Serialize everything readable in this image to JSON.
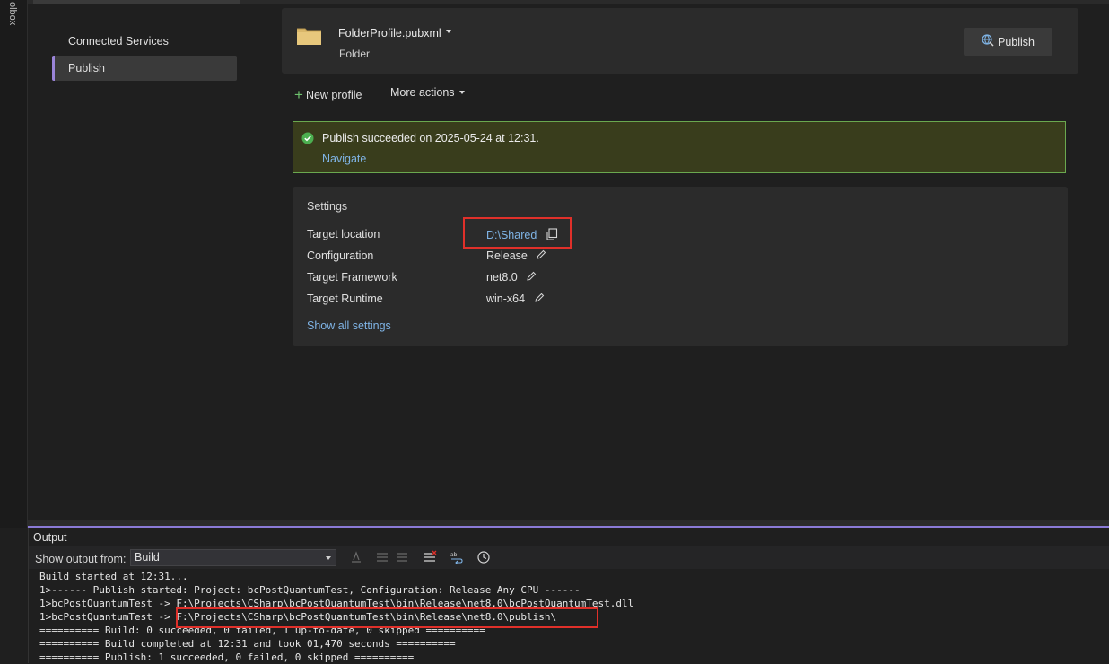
{
  "toolbox": {
    "label": "olbox"
  },
  "nav": {
    "items": [
      {
        "label": "Connected Services",
        "active": false
      },
      {
        "label": "Publish",
        "active": true
      }
    ]
  },
  "profile": {
    "name": "FolderProfile.pubxml",
    "type": "Folder",
    "publish_label": "Publish",
    "folder_icon": "folder-icon",
    "publish_icon": "globe-publish-icon"
  },
  "actions": {
    "new_profile": "New profile",
    "more_actions": "More actions"
  },
  "banner": {
    "message": "Publish succeeded on 2025-05-24 at 12:31.",
    "link": "Navigate",
    "status_color": "#6aa84f"
  },
  "settings": {
    "title": "Settings",
    "rows": [
      {
        "label": "Target location",
        "value": "D:\\Shared",
        "icon": "copy-icon"
      },
      {
        "label": "Configuration",
        "value": "Release",
        "icon": "pencil-icon"
      },
      {
        "label": "Target Framework",
        "value": "net8.0",
        "icon": "pencil-icon"
      },
      {
        "label": "Target Runtime",
        "value": "win-x64",
        "icon": "pencil-icon"
      }
    ],
    "show_all": "Show all settings"
  },
  "output": {
    "title": "Output",
    "show_from_label": "Show output from:",
    "source": "Build",
    "lines": [
      "Build started at 12:31...",
      "1>------ Publish started: Project: bcPostQuantumTest, Configuration: Release Any CPU ------",
      "1>bcPostQuantumTest -> F:\\Projects\\CSharp\\bcPostQuantumTest\\bin\\Release\\net8.0\\bcPostQuantumTest.dll",
      "1>bcPostQuantumTest -> F:\\Projects\\CSharp\\bcPostQuantumTest\\bin\\Release\\net8.0\\publish\\",
      "========== Build: 0 succeeded, 0 failed, 1 up-to-date, 0 skipped ==========",
      "========== Build completed at 12:31 and took 01,470 seconds ==========",
      "========== Publish: 1 succeeded, 0 failed, 0 skipped =========="
    ]
  },
  "colors": {
    "accent": "#8a7ad6",
    "link": "#7fb4e6",
    "highlight": "#e0302a"
  }
}
